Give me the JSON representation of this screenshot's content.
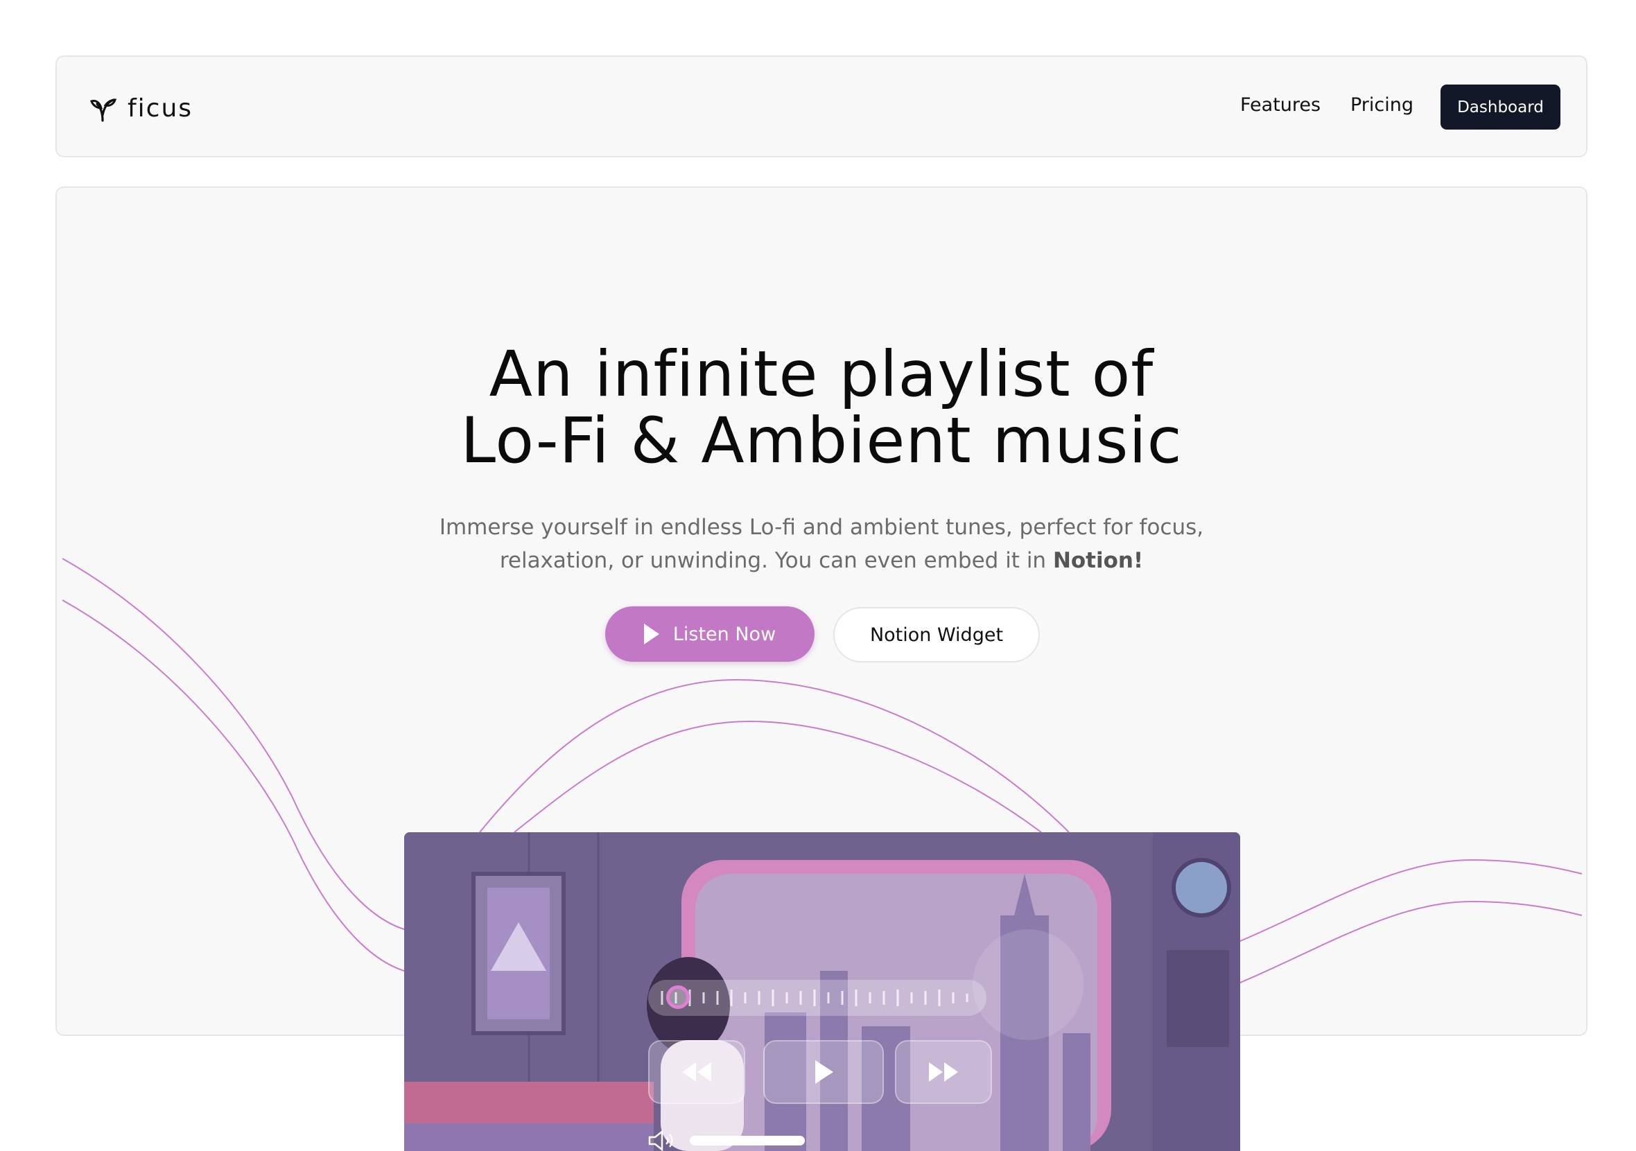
{
  "nav": {
    "brand": "ficus",
    "links": [
      "Features",
      "Pricing"
    ],
    "cta": "Dashboard"
  },
  "hero": {
    "title_line1": "An infinite playlist of",
    "title_line2": "Lo-Fi & Ambient music",
    "subtitle_line1": "Immerse yourself in endless Lo-fi and ambient tunes, perfect for focus,",
    "subtitle_line2_prefix": "relaxation, or unwinding. You can even embed it in ",
    "subtitle_line2_bold": "Notion!",
    "primary_button": "Listen Now",
    "secondary_button": "Notion Widget"
  },
  "player": {
    "progress": 0.04,
    "accent_color": "#c278c5",
    "controls": [
      "rewind-icon",
      "play-icon",
      "fast-forward-icon"
    ],
    "volume_icon": "speaker-icon"
  },
  "colors": {
    "accent": "#c278c5",
    "dark_button": "#121828",
    "wave": "#c97ccb"
  }
}
